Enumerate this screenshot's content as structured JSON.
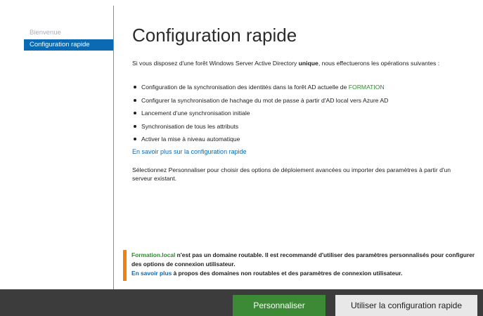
{
  "sidebar": {
    "items": [
      {
        "label": "Bienvenue"
      },
      {
        "label": "Configuration rapide"
      }
    ]
  },
  "main": {
    "title": "Configuration rapide",
    "intro_before": "Si vous disposez d'une forêt Windows Server Active Directory ",
    "intro_bold": "unique",
    "intro_after": ", nous effectuerons les opérations suivantes :",
    "bullets": [
      {
        "text": "Configuration de la synchronisation des identités dans la forêt AD actuelle de ",
        "highlight": "FORMATION"
      },
      {
        "text": "Configurer la synchronisation de hachage du mot de passe à partir d'AD local vers Azure AD"
      },
      {
        "text": "Lancement d'une synchronisation initiale"
      },
      {
        "text": "Synchronisation de tous les attributs"
      },
      {
        "text": "Activer la mise à niveau automatique"
      }
    ],
    "learn_more_link": "En savoir plus sur la configuration rapide",
    "customize_text": "Sélectionnez Personnaliser pour choisir des options de déploiement avancées ou importer des paramètres à partir d'un serveur existant."
  },
  "warning": {
    "domain": "Formation.local",
    "message": " n'est pas un domaine routable. Il est recommandé d'utiliser des paramètres personnalisés pour configurer des options de connexion utilisateur.",
    "link": "En savoir plus",
    "link_suffix": " à propos des domaines non routables et des paramètres de connexion utilisateur."
  },
  "footer": {
    "customize_button": "Personnaliser",
    "express_button": "Utiliser la configuration rapide"
  },
  "colors": {
    "accent_blue": "#0a6ab3",
    "highlight_green": "#2e8b2e",
    "warning_orange": "#f0810f",
    "primary_button": "#3d8a36",
    "footer_bg": "#3c3c3c"
  }
}
